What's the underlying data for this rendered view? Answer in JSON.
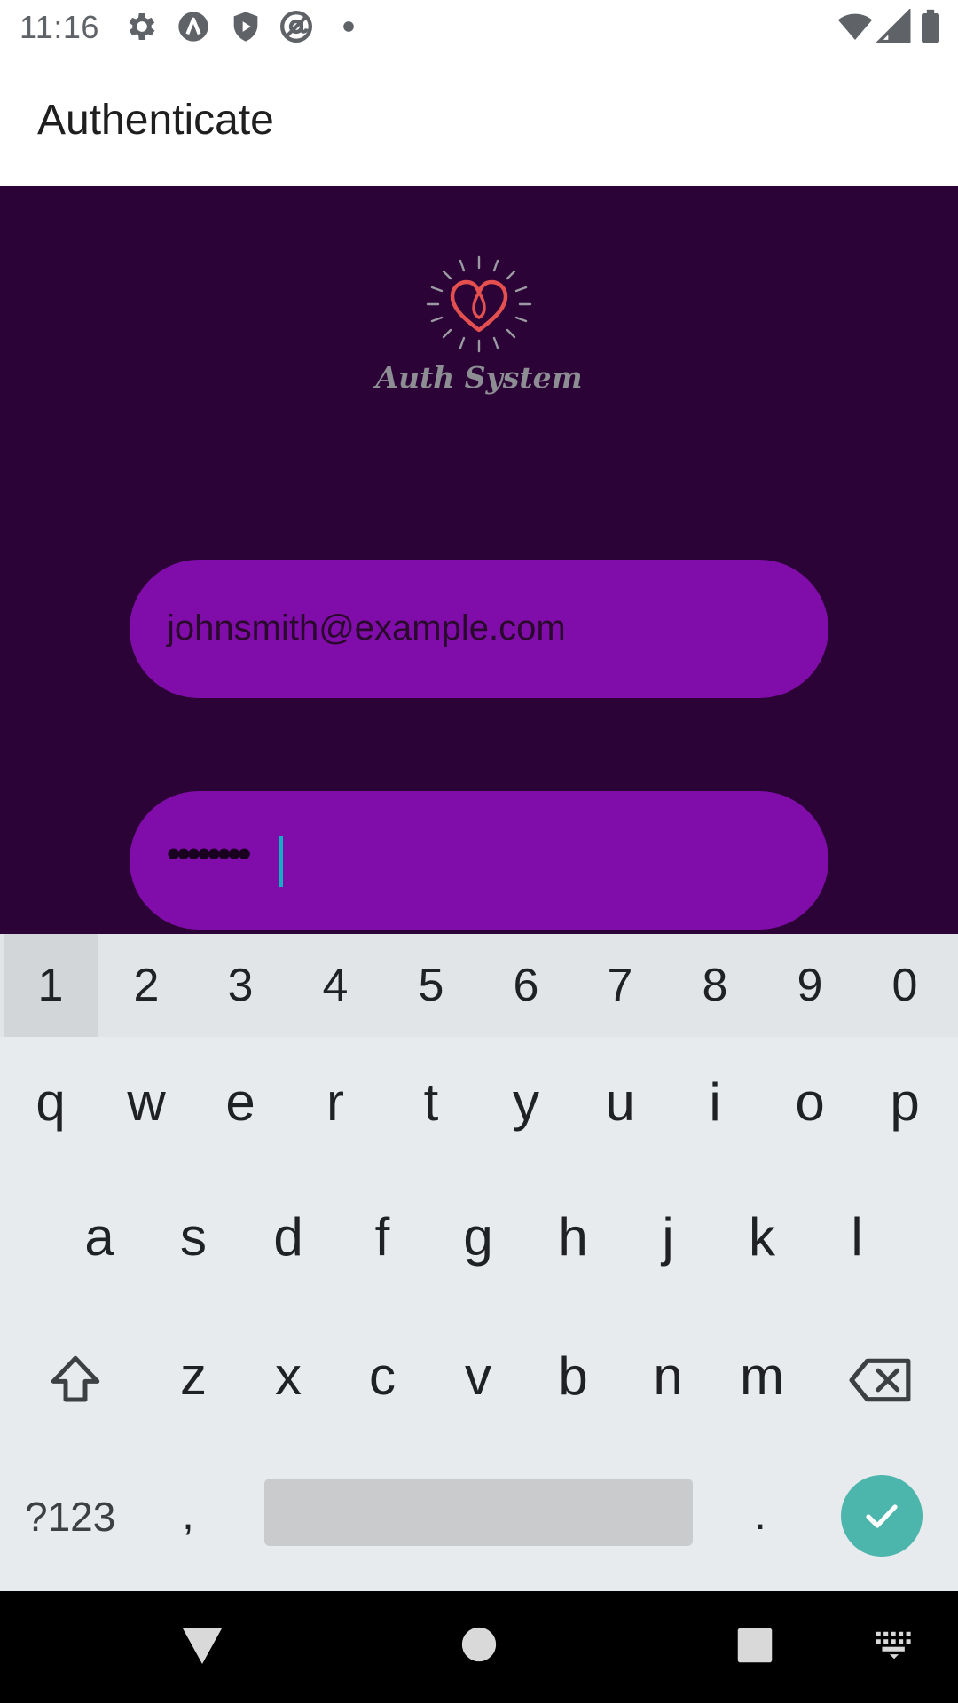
{
  "status_bar": {
    "time": "11:16",
    "icons": [
      "gear-icon",
      "a-circle-icon",
      "shield-play-icon",
      "at-sign-icon",
      "dot-icon",
      "wifi-icon",
      "cell-signal-icon",
      "battery-icon"
    ]
  },
  "app_bar": {
    "title": "Authenticate"
  },
  "logo": {
    "text": "Auth System",
    "icon": "heart-sunburst-icon",
    "heart_color": "#e3504f"
  },
  "form": {
    "email_value": "johnsmith@example.com",
    "password_masked": "••••••••",
    "field_color": "#800ca9",
    "background_color": "#2c0336"
  },
  "keyboard": {
    "number_row": [
      "1",
      "2",
      "3",
      "4",
      "5",
      "6",
      "7",
      "8",
      "9",
      "0"
    ],
    "row_1": [
      "q",
      "w",
      "e",
      "r",
      "t",
      "y",
      "u",
      "i",
      "o",
      "p"
    ],
    "row_2": [
      "a",
      "s",
      "d",
      "f",
      "g",
      "h",
      "j",
      "k",
      "l"
    ],
    "row_3": [
      "z",
      "x",
      "c",
      "v",
      "b",
      "n",
      "m"
    ],
    "symbols_label": "?123",
    "comma": ",",
    "period": ".",
    "accent_color": "#4db6ac"
  },
  "nav_bar": {
    "icons": [
      "back-icon",
      "home-icon",
      "recents-icon",
      "keyboard-switch-icon"
    ]
  }
}
